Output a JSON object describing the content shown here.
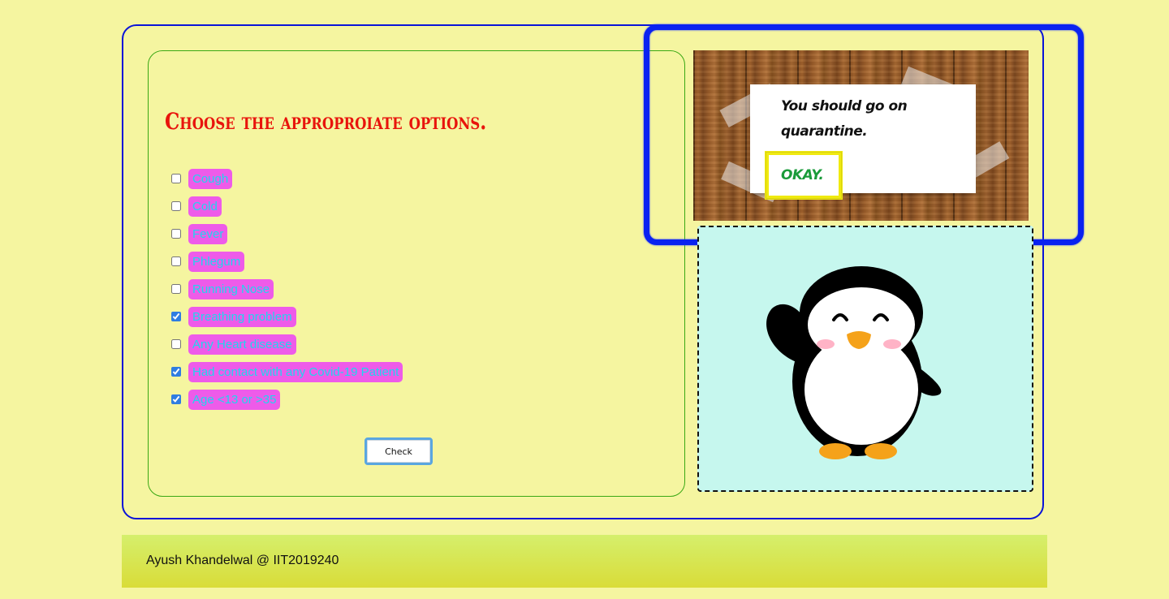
{
  "form": {
    "heading": "Choose the approproiate options.",
    "options": [
      {
        "label": "Cough",
        "checked": false
      },
      {
        "label": "Cold",
        "checked": false
      },
      {
        "label": "Fever",
        "checked": false
      },
      {
        "label": "Phlegum",
        "checked": false
      },
      {
        "label": "Running Nose",
        "checked": false
      },
      {
        "label": "Breathing problem",
        "checked": true
      },
      {
        "label": "Any Heart disease",
        "checked": false
      },
      {
        "label": "Had contact with any Covid-19 Patient",
        "checked": true
      },
      {
        "label": "Age <13 or >35",
        "checked": true
      }
    ],
    "check_label": "Check"
  },
  "result": {
    "message": "You should go on quarantine.",
    "okay_label": "OKAY."
  },
  "footer": {
    "text": "Ayush Khandelwal @ IIT2019240"
  },
  "colors": {
    "background": "#f5f5a0",
    "heading": "#e8140c",
    "pill": "#ee5be9",
    "pill_text": "#1ed6ee",
    "okay_text": "#1a9b3a",
    "highlight": "#0a22f0",
    "okay_highlight": "#f0ea10",
    "penguin_bg": "#c6f7ee"
  },
  "icons": {
    "mascot": "penguin-waving"
  }
}
